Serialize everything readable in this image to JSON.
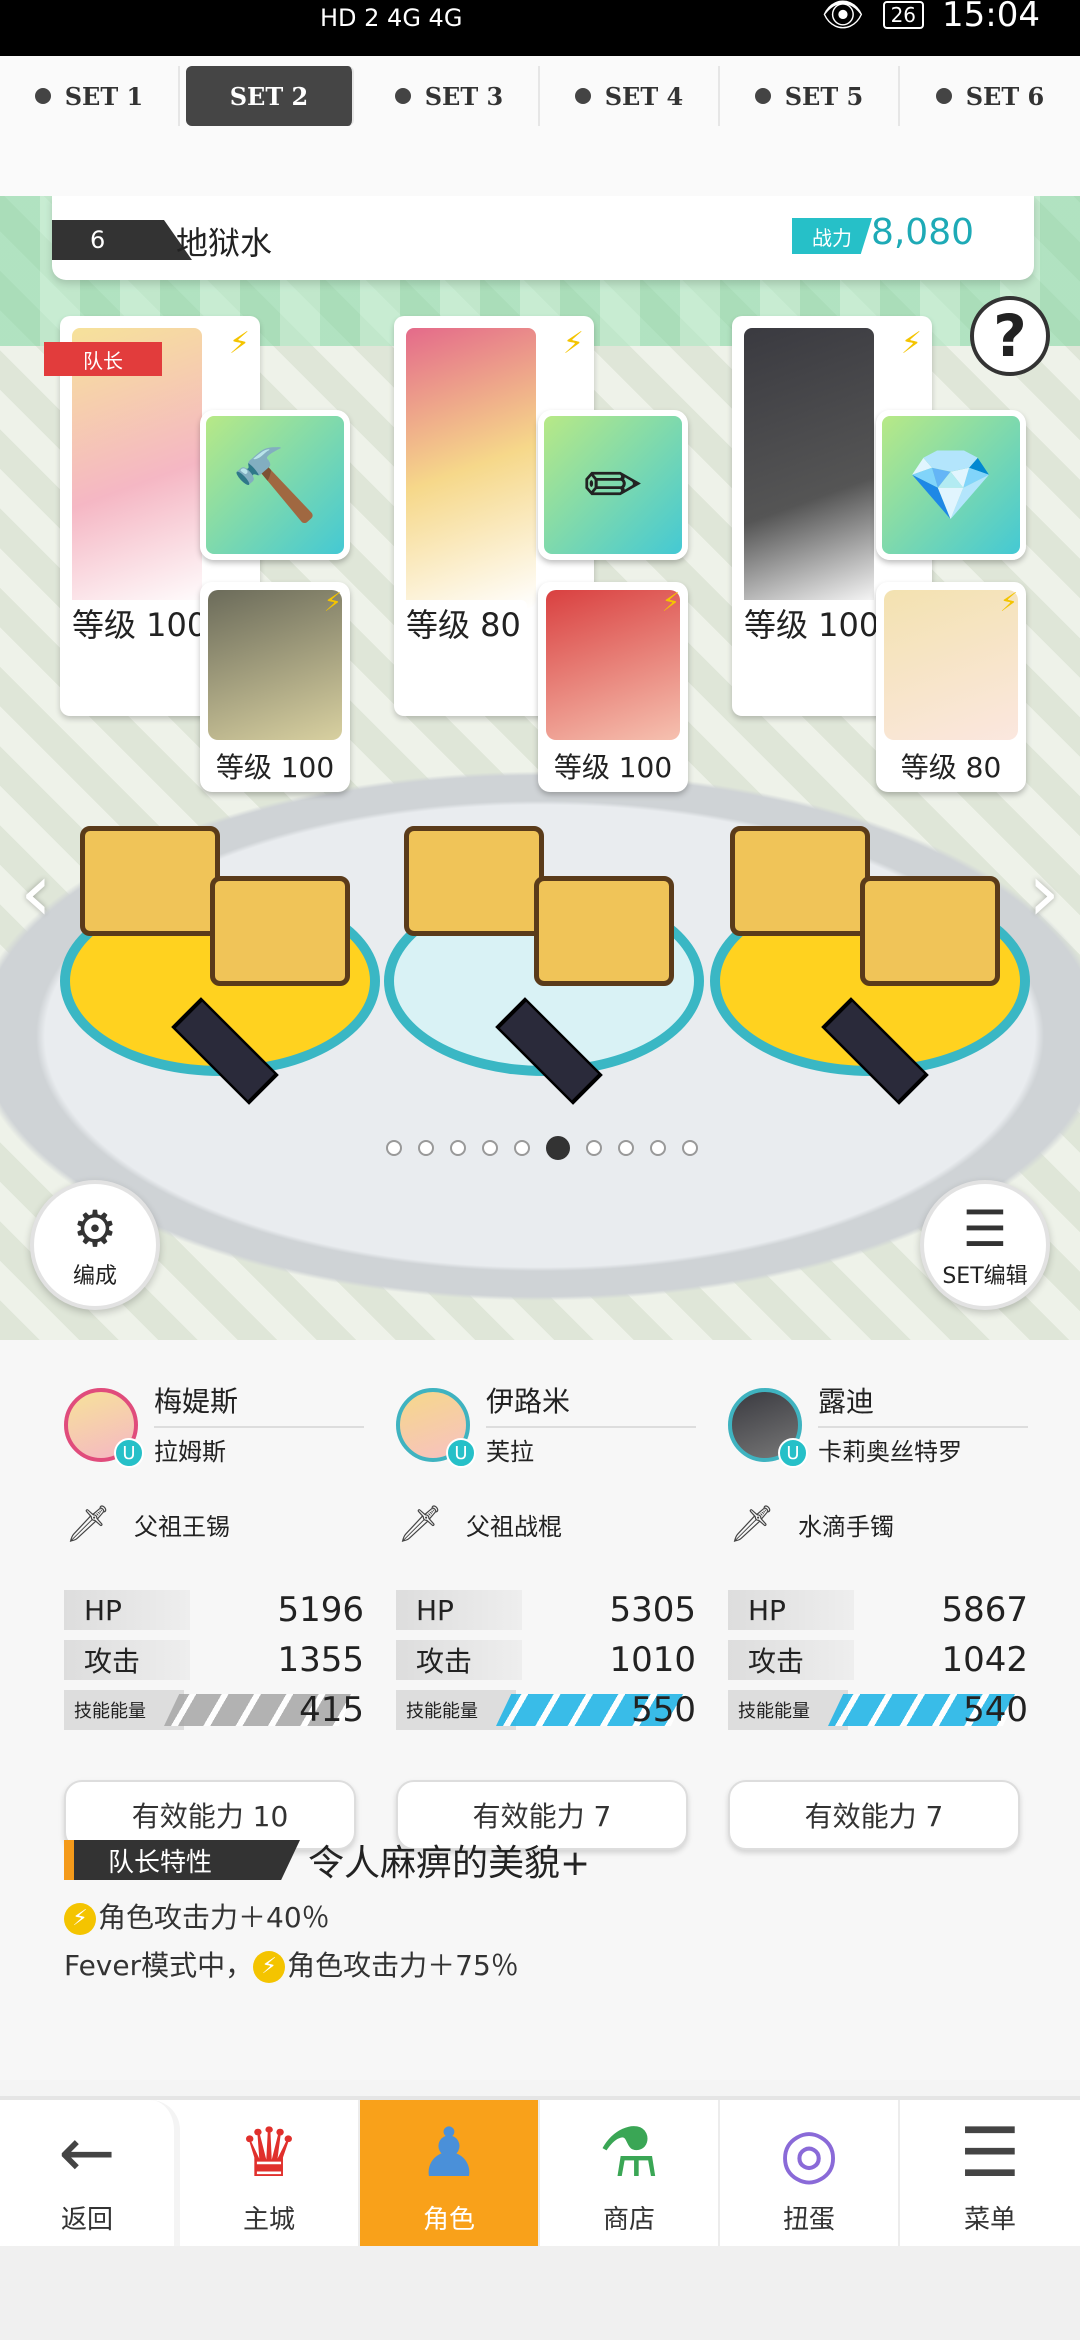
{
  "status_bar": {
    "left_indicators": "HD 2  4G  4G",
    "time": "15:04",
    "battery": "26"
  },
  "set_tabs": [
    {
      "label": "SET 1",
      "active": false
    },
    {
      "label": "SET 2",
      "active": true
    },
    {
      "label": "SET 3",
      "active": false
    },
    {
      "label": "SET 4",
      "active": false
    },
    {
      "label": "SET 5",
      "active": false
    },
    {
      "label": "SET 6",
      "active": false
    }
  ],
  "team": {
    "number": "6",
    "name": "地狱水",
    "power_label": "战力",
    "power_value": "8,080"
  },
  "leader_tag": "队长",
  "cards": [
    {
      "level": "等级 100",
      "sub_level": "等级 100"
    },
    {
      "level": "等级 80",
      "sub_level": "等级 100"
    },
    {
      "level": "等级 100",
      "sub_level": "等级 80"
    }
  ],
  "page_dots": {
    "count": 10,
    "active_index": 5
  },
  "buttons": {
    "formation": "编成",
    "set_edit": "SET编辑",
    "help": "?"
  },
  "icons": {
    "back": "arrow-left-icon",
    "home": "castle-icon",
    "character": "character-icon",
    "shop": "shop-icon",
    "gacha": "gacha-icon",
    "menu": "menu-icon"
  },
  "members": [
    {
      "name": "梅媞斯",
      "sub_name": "拉姆斯",
      "weapon": "父祖王锡",
      "hp_label": "HP",
      "hp": "5196",
      "atk_label": "攻击",
      "atk": "1355",
      "skill_label": "技能能量",
      "skill": "415",
      "ability": "有效能力 10"
    },
    {
      "name": "伊路米",
      "sub_name": "芙拉",
      "weapon": "父祖战棍",
      "hp_label": "HP",
      "hp": "5305",
      "atk_label": "攻击",
      "atk": "1010",
      "skill_label": "技能能量",
      "skill": "550",
      "ability": "有效能力 7"
    },
    {
      "name": "露迪",
      "sub_name": "卡莉奥丝特罗",
      "weapon": "水滴手镯",
      "hp_label": "HP",
      "hp": "5867",
      "atk_label": "攻击",
      "atk": "1042",
      "skill_label": "技能能量",
      "skill": "540",
      "ability": "有效能力 7"
    }
  ],
  "leader_skill": {
    "tag": "队长特性",
    "title": "令人麻痹的美貌+",
    "line1": "角色攻击力＋40％",
    "line2_prefix": "Fever模式中，",
    "line2": "角色攻击力＋75％"
  },
  "bottom_nav": [
    {
      "label": "返回",
      "active": false
    },
    {
      "label": "主城",
      "active": false
    },
    {
      "label": "角色",
      "active": true
    },
    {
      "label": "商店",
      "active": false
    },
    {
      "label": "扭蛋",
      "active": false
    },
    {
      "label": "菜单",
      "active": false
    }
  ],
  "colors": {
    "accent": "#f9a11a",
    "power": "#1eaab6",
    "skill_bar": "#24b5e6",
    "leader_tag": "#e23c3c"
  }
}
